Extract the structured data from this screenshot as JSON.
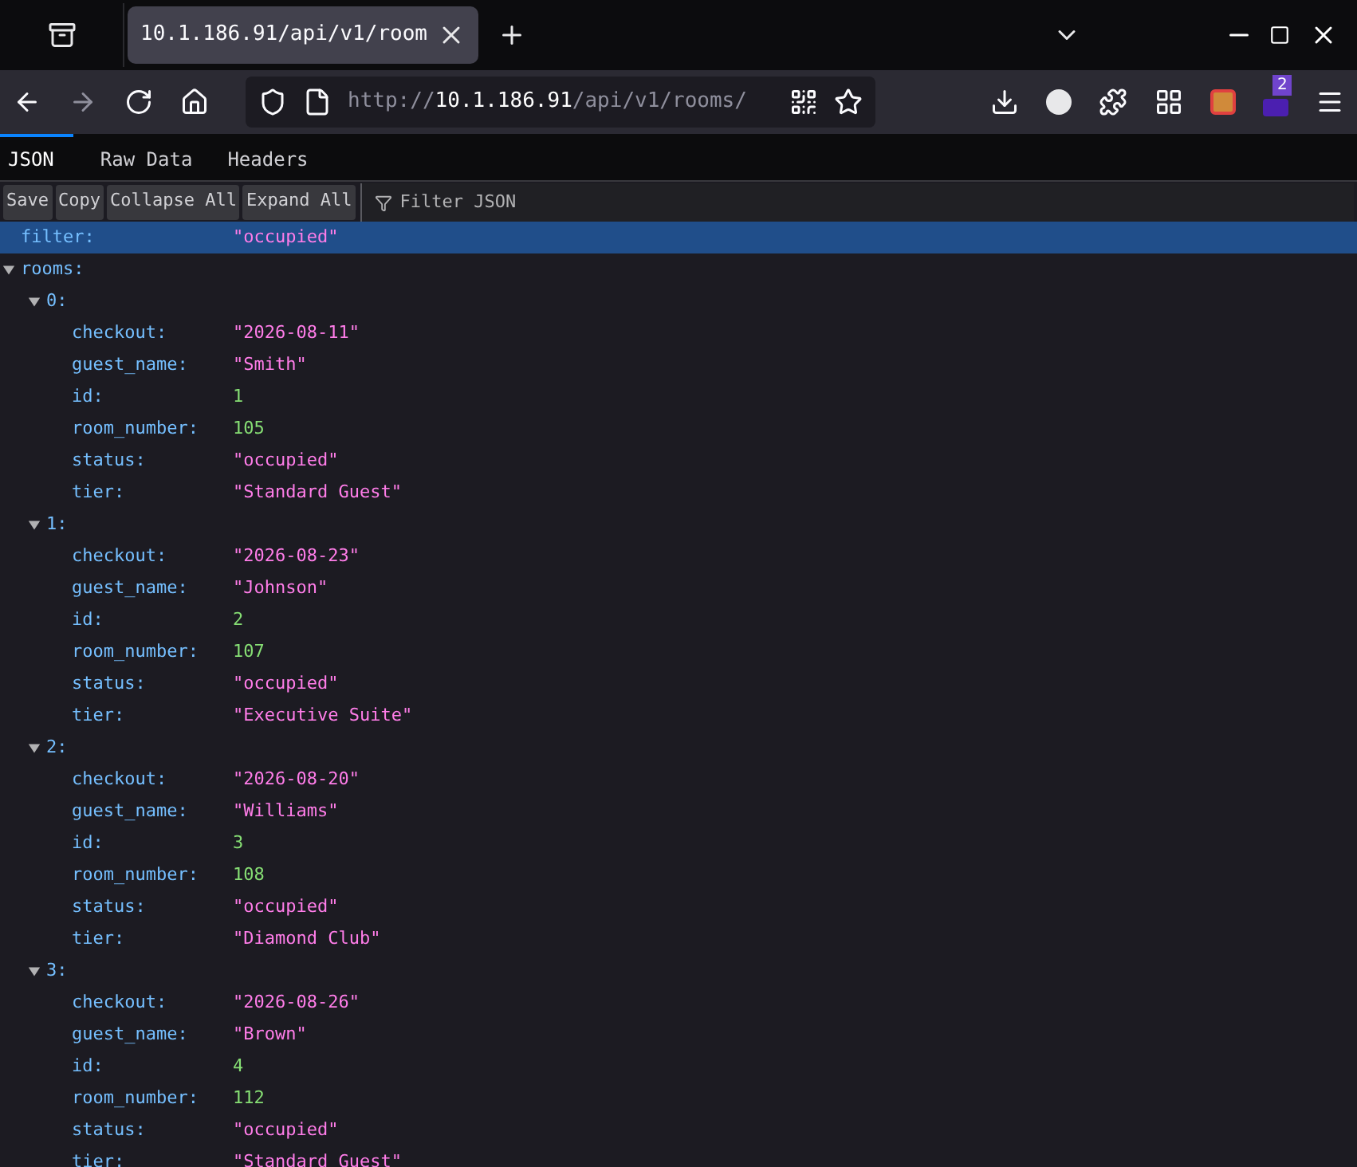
{
  "browser_tab": {
    "title": "10.1.186.91/api/v1/room",
    "selected": true
  },
  "address_bar": {
    "scheme": "http://",
    "host": "10.1.186.91",
    "path": "/api/v1/rooms/"
  },
  "extension_badge": "2",
  "viewer_tabs": [
    {
      "label": "JSON",
      "selected": true
    },
    {
      "label": "Raw Data",
      "selected": false
    },
    {
      "label": "Headers",
      "selected": false
    }
  ],
  "toolbar_buttons": [
    "Save",
    "Copy",
    "Collapse All",
    "Expand All"
  ],
  "filter": {
    "placeholder": "Filter JSON"
  },
  "tree": [
    {
      "key": "filter:",
      "kind": "string",
      "value": "\"occupied\"",
      "selected": true
    },
    {
      "key": "rooms:",
      "kind": "object",
      "expanded": true,
      "selected": false,
      "children": [
        {
          "key": "0:",
          "kind": "object",
          "expanded": true,
          "selected": false,
          "children": [
            {
              "key": "checkout:",
              "kind": "string",
              "value": "\"2026-08-11\"",
              "selected": false
            },
            {
              "key": "guest_name:",
              "kind": "string",
              "value": "\"Smith\"",
              "selected": false
            },
            {
              "key": "id:",
              "kind": "number",
              "value": "1",
              "selected": false
            },
            {
              "key": "room_number:",
              "kind": "number",
              "value": "105",
              "selected": false
            },
            {
              "key": "status:",
              "kind": "string",
              "value": "\"occupied\"",
              "selected": false
            },
            {
              "key": "tier:",
              "kind": "string",
              "value": "\"Standard Guest\"",
              "selected": false
            }
          ]
        },
        {
          "key": "1:",
          "kind": "object",
          "expanded": true,
          "selected": false,
          "children": [
            {
              "key": "checkout:",
              "kind": "string",
              "value": "\"2026-08-23\"",
              "selected": false
            },
            {
              "key": "guest_name:",
              "kind": "string",
              "value": "\"Johnson\"",
              "selected": false
            },
            {
              "key": "id:",
              "kind": "number",
              "value": "2",
              "selected": false
            },
            {
              "key": "room_number:",
              "kind": "number",
              "value": "107",
              "selected": false
            },
            {
              "key": "status:",
              "kind": "string",
              "value": "\"occupied\"",
              "selected": false
            },
            {
              "key": "tier:",
              "kind": "string",
              "value": "\"Executive Suite\"",
              "selected": false
            }
          ]
        },
        {
          "key": "2:",
          "kind": "object",
          "expanded": true,
          "selected": false,
          "children": [
            {
              "key": "checkout:",
              "kind": "string",
              "value": "\"2026-08-20\"",
              "selected": false
            },
            {
              "key": "guest_name:",
              "kind": "string",
              "value": "\"Williams\"",
              "selected": false
            },
            {
              "key": "id:",
              "kind": "number",
              "value": "3",
              "selected": false
            },
            {
              "key": "room_number:",
              "kind": "number",
              "value": "108",
              "selected": false
            },
            {
              "key": "status:",
              "kind": "string",
              "value": "\"occupied\"",
              "selected": false
            },
            {
              "key": "tier:",
              "kind": "string",
              "value": "\"Diamond Club\"",
              "selected": false
            }
          ]
        },
        {
          "key": "3:",
          "kind": "object",
          "expanded": true,
          "selected": false,
          "children": [
            {
              "key": "checkout:",
              "kind": "string",
              "value": "\"2026-08-26\"",
              "selected": false
            },
            {
              "key": "guest_name:",
              "kind": "string",
              "value": "\"Brown\"",
              "selected": false
            },
            {
              "key": "id:",
              "kind": "number",
              "value": "4",
              "selected": false
            },
            {
              "key": "room_number:",
              "kind": "number",
              "value": "112",
              "selected": false
            },
            {
              "key": "status:",
              "kind": "string",
              "value": "\"occupied\"",
              "selected": false
            },
            {
              "key": "tier:",
              "kind": "string",
              "value": "\"Standard Guest\"",
              "selected": false
            }
          ]
        }
      ]
    }
  ]
}
